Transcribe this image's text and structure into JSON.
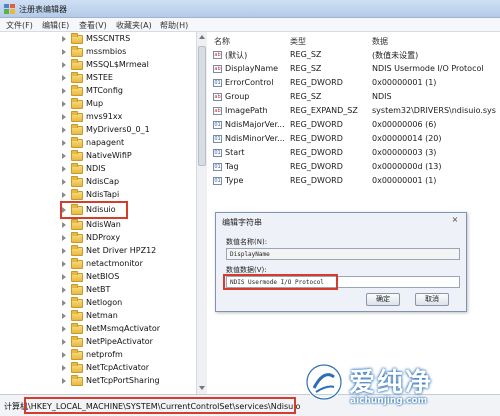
{
  "window": {
    "title": "注册表编辑器"
  },
  "menu": [
    "文件(F)",
    "编辑(E)",
    "查看(V)",
    "收藏夹(A)",
    "帮助(H)"
  ],
  "tree": {
    "items": [
      "MSSCNTRS",
      "mssmbios",
      "MSSQL$Mrmeal",
      "MSTEE",
      "MTConfig",
      "Mup",
      "mvs91xx",
      "MyDrivers0_0_1",
      "napagent",
      "NativeWifiP",
      "NDIS",
      "NdisCap",
      "NdisTapi",
      "Ndisuio",
      "NdisWan",
      "NDProxy",
      "Net Driver HPZ12",
      "netactmonitor",
      "NetBIOS",
      "NetBT",
      "Netlogon",
      "Netman",
      "NetMsmqActivator",
      "NetPipeActivator",
      "netprofm",
      "NetTcpActivator",
      "NetTcpPortSharing"
    ],
    "selected": "Ndisuio"
  },
  "values": {
    "headers": {
      "name": "名称",
      "type": "类型",
      "data": "数据"
    },
    "rows": [
      {
        "icon": "string-value-icon",
        "name": "(默认)",
        "type": "REG_SZ",
        "data": "(数值未设置)"
      },
      {
        "icon": "string-value-icon",
        "name": "DisplayName",
        "type": "REG_SZ",
        "data": "NDIS Usermode I/O Protocol"
      },
      {
        "icon": "binary-value-icon",
        "name": "ErrorControl",
        "type": "REG_DWORD",
        "data": "0x00000001 (1)"
      },
      {
        "icon": "string-value-icon",
        "name": "Group",
        "type": "REG_SZ",
        "data": "NDIS"
      },
      {
        "icon": "string-value-icon",
        "name": "ImagePath",
        "type": "REG_EXPAND_SZ",
        "data": "system32\\DRIVERS\\ndisuio.sys"
      },
      {
        "icon": "binary-value-icon",
        "name": "NdisMajorVer...",
        "type": "REG_DWORD",
        "data": "0x00000006 (6)"
      },
      {
        "icon": "binary-value-icon",
        "name": "NdisMinorVer...",
        "type": "REG_DWORD",
        "data": "0x00000014 (20)"
      },
      {
        "icon": "binary-value-icon",
        "name": "Start",
        "type": "REG_DWORD",
        "data": "0x00000003 (3)"
      },
      {
        "icon": "binary-value-icon",
        "name": "Tag",
        "type": "REG_DWORD",
        "data": "0x0000000d (13)"
      },
      {
        "icon": "binary-value-icon",
        "name": "Type",
        "type": "REG_DWORD",
        "data": "0x00000001 (1)"
      }
    ]
  },
  "dialog": {
    "title": "编辑字符串",
    "close": "×",
    "name_label": "数值名称(N):",
    "name_value": "DisplayName",
    "data_label": "数值数据(V):",
    "data_value": "NDIS Usermode I/O Protocol",
    "ok": "确定",
    "cancel": "取消"
  },
  "status": {
    "path": "计算机\\HKEY_LOCAL_MACHINE\\SYSTEM\\CurrentControlSet\\services\\Ndisuio"
  },
  "watermark": {
    "brand": "爱纯净",
    "url": "aichunjing.com"
  },
  "colors": {
    "highlight": "#d43c2c",
    "accent": "#2a6fb8"
  }
}
